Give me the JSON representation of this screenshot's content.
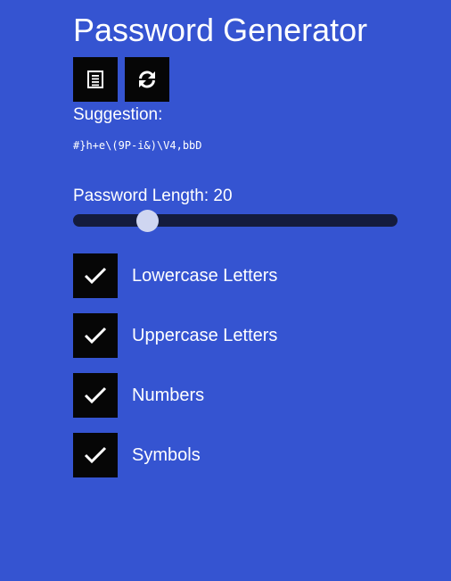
{
  "header": {
    "title": "Password Generator"
  },
  "actions": {
    "copy_icon": "clipboard-list-icon",
    "refresh_icon": "refresh-icon"
  },
  "suggestion": {
    "label": "Suggestion:",
    "value": "#}h+e\\(9P-i&)\\V4,bbD"
  },
  "length": {
    "label": "Password Length: 20",
    "value": 20,
    "min": 8,
    "max": 64,
    "fraction": 0.21
  },
  "options": [
    {
      "label": "Lowercase Letters",
      "checked": true
    },
    {
      "label": "Uppercase Letters",
      "checked": true
    },
    {
      "label": "Numbers",
      "checked": true
    },
    {
      "label": "Symbols",
      "checked": true
    }
  ],
  "colors": {
    "background": "#3554d1",
    "button": "#060606",
    "slider_track": "#141c3e",
    "slider_thumb": "#cfd6f1",
    "text": "#ffffff"
  }
}
